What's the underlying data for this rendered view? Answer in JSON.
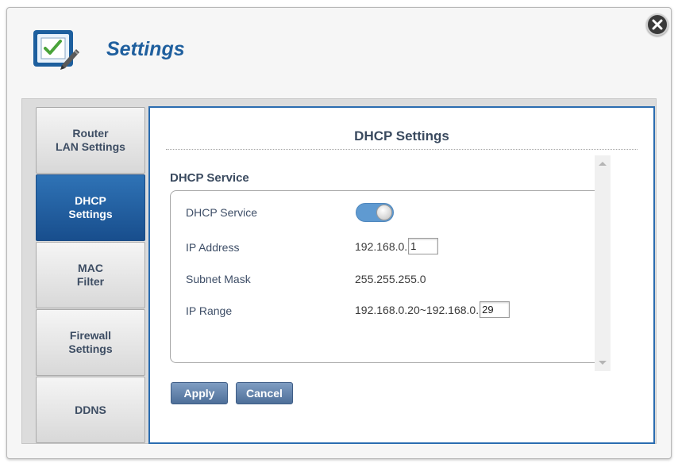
{
  "header": {
    "title": "Settings",
    "icon": "settings-checklist-icon"
  },
  "sidebar": {
    "items": [
      {
        "label": "Router\nLAN Settings",
        "active": false
      },
      {
        "label": "DHCP\nSettings",
        "active": true
      },
      {
        "label": "MAC\nFilter",
        "active": false
      },
      {
        "label": "Firewall\nSettings",
        "active": false
      },
      {
        "label": "DDNS",
        "active": false
      }
    ]
  },
  "main": {
    "title": "DHCP Settings",
    "section_title": "DHCP Service",
    "rows": {
      "dhcp_service": {
        "label": "DHCP Service",
        "enabled": true
      },
      "ip_address": {
        "label": "IP Address",
        "prefix": "192.168.0.",
        "value": "1"
      },
      "subnet_mask": {
        "label": "Subnet Mask",
        "value": "255.255.255.0"
      },
      "ip_range": {
        "label": "IP Range",
        "prefix": "192.168.0.20~192.168.0.",
        "value": "29"
      }
    },
    "buttons": {
      "apply": "Apply",
      "cancel": "Cancel"
    }
  },
  "colors": {
    "accent": "#2a6cb0",
    "active_tab": "#1f5f9e",
    "toggle_on": "#5f9ad1"
  }
}
